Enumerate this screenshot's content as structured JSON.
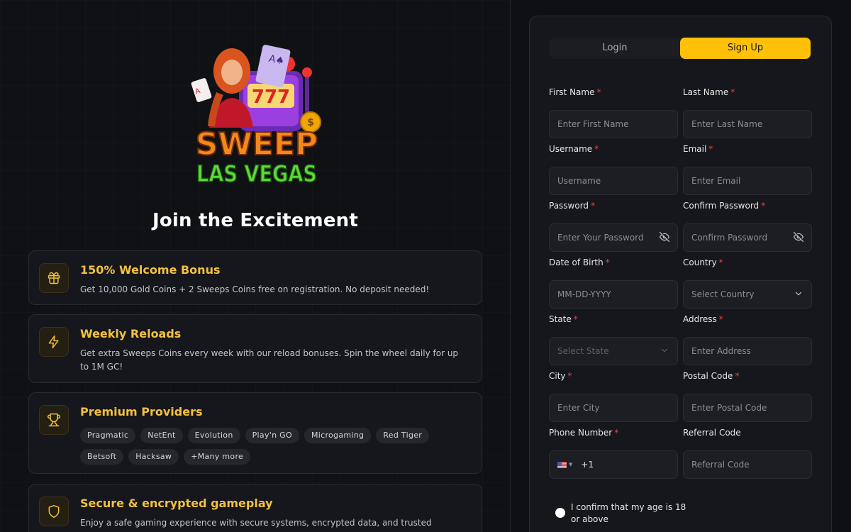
{
  "brand": {
    "logo_line1": "SWEEP",
    "logo_line2": "LAS VEGAS",
    "logo_reels": "777"
  },
  "left": {
    "headline": "Join the Excitement",
    "features": [
      {
        "title": "150% Welcome Bonus",
        "description": "Get 10,000 Gold Coins + 2 Sweeps Coins free on registration. No deposit needed!",
        "icon": "gift-icon"
      },
      {
        "title": "Weekly Reloads",
        "description": "Get extra Sweeps Coins every week with our reload bonuses. Spin the wheel daily for up to 1M GC!",
        "icon": "lightning-icon"
      },
      {
        "title": "Premium Providers",
        "icon": "trophy-icon",
        "providers": [
          "Pragmatic",
          "NetEnt",
          "Evolution",
          "Play'n GO",
          "Microgaming",
          "Red Tiger",
          "Betsoft",
          "Hacksaw",
          "+Many more"
        ]
      },
      {
        "title": "Secure & encrypted gameplay",
        "description": "Enjoy a safe gaming experience with secure systems, encrypted data, and trusted protection.",
        "icon": "shield-icon"
      }
    ]
  },
  "form": {
    "tabs": [
      {
        "label": "Login",
        "active": false
      },
      {
        "label": "Sign Up",
        "active": true
      }
    ],
    "required_mark": "*",
    "fields": {
      "first_name": {
        "label": "First Name",
        "placeholder": "Enter First Name"
      },
      "last_name": {
        "label": "Last Name",
        "placeholder": "Enter Last Name"
      },
      "username": {
        "label": "Username",
        "placeholder": "Username"
      },
      "email": {
        "label": "Email",
        "placeholder": "Enter Email"
      },
      "password": {
        "label": "Password",
        "placeholder": "Enter Your Password"
      },
      "confirm_password": {
        "label": "Confirm Password",
        "placeholder": "Confirm Password"
      },
      "dob": {
        "label": "Date of Birth",
        "placeholder": "MM-DD-YYYY"
      },
      "country": {
        "label": "Country",
        "placeholder": "Select Country"
      },
      "state": {
        "label": "State",
        "placeholder": "Select State"
      },
      "address": {
        "label": "Address",
        "placeholder": "Enter Address"
      },
      "city": {
        "label": "City",
        "placeholder": "Enter City"
      },
      "postal_code": {
        "label": "Postal Code",
        "placeholder": "Enter Postal Code"
      },
      "phone": {
        "label": "Phone Number",
        "country_code": "+1"
      },
      "referral": {
        "label": "Referral Code",
        "placeholder": "Referral Code"
      }
    },
    "age_confirm": "I confirm that my age is 18 or above"
  },
  "colors": {
    "accent": "#ffc107",
    "feature_title": "#f5c13d",
    "required": "#ef4444",
    "background": "#0f1014"
  }
}
